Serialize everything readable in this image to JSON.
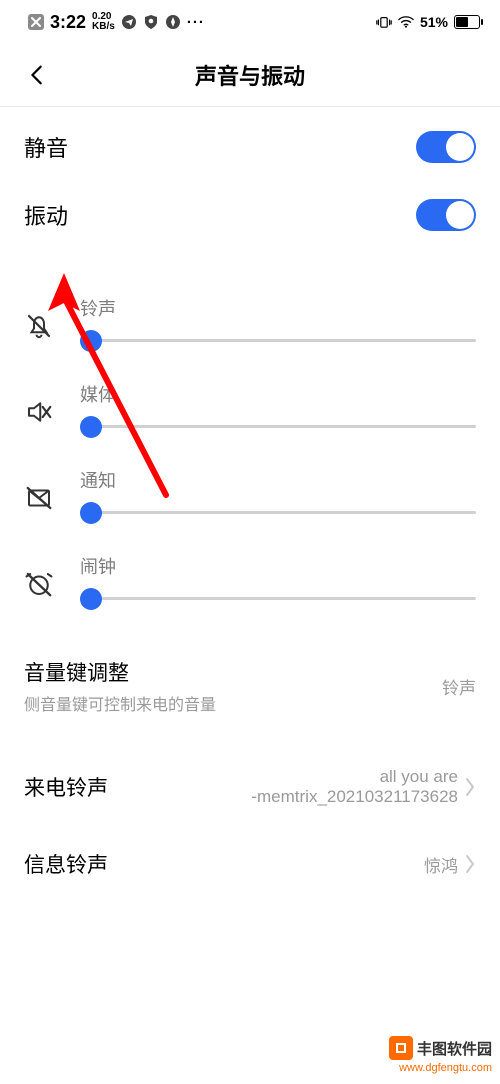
{
  "status": {
    "time": "3:22",
    "speed_top": "0.20",
    "speed_bottom": "KB/s",
    "battery_pct": "51%"
  },
  "header": {
    "title": "声音与振动"
  },
  "toggles": {
    "mute_label": "静音",
    "vibrate_label": "振动"
  },
  "sliders": {
    "ringtone": "铃声",
    "media": "媒体",
    "notification": "通知",
    "alarm": "闹钟"
  },
  "settings": {
    "volume_key": {
      "title": "音量键调整",
      "sub": "侧音量键可控制来电的音量",
      "value": "铃声"
    },
    "call_ring": {
      "title": "来电铃声",
      "value_line1": "all you are",
      "value_line2": "-memtrix_20210321173628"
    },
    "sms_ring": {
      "title": "信息铃声",
      "value": "惊鸿"
    }
  },
  "watermark": {
    "name": "丰图软件园",
    "url": "www.dgfengtu.com"
  }
}
